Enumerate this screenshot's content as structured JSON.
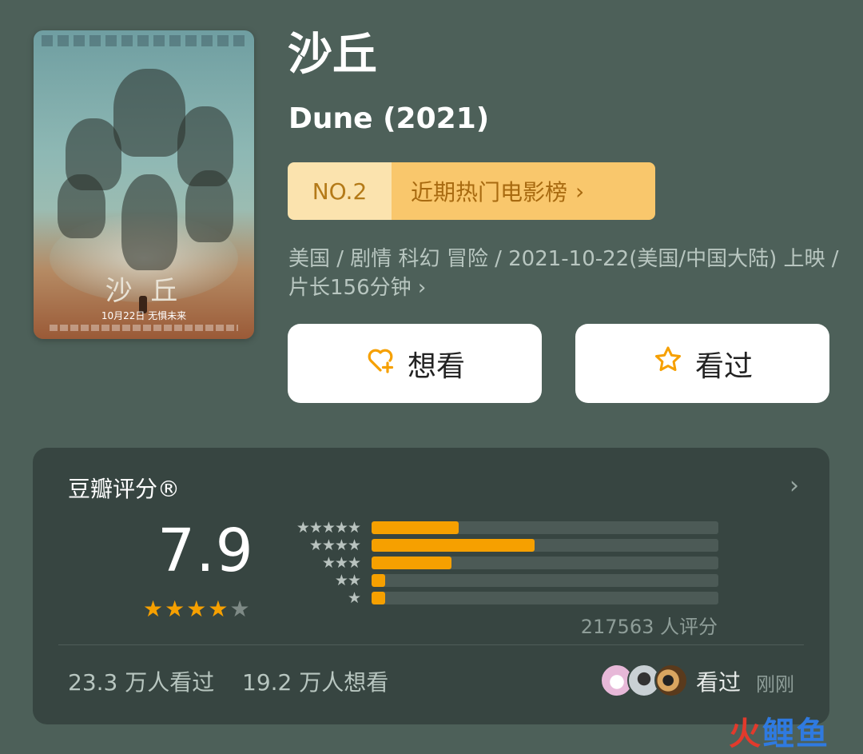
{
  "poster": {
    "title_art": "沙 丘",
    "date_line": "10月22日 无惧未来"
  },
  "movie": {
    "title_zh": "沙丘",
    "title_en": "Dune (2021)",
    "rank_label": "NO.2",
    "rank_list": "近期热门电影榜",
    "meta": "美国 / 剧情 科幻 冒险 / 2021-10-22(美国/中国大陆) 上映 / 片长156分钟"
  },
  "actions": {
    "want_label": "想看",
    "seen_label": "看过"
  },
  "rating": {
    "section_title": "豆瓣评分®",
    "score": "7.9",
    "stars": 4,
    "distribution": [
      {
        "stars": 5,
        "fraction": 0.25
      },
      {
        "stars": 4,
        "fraction": 0.47
      },
      {
        "stars": 3,
        "fraction": 0.23
      },
      {
        "stars": 2,
        "fraction": 0.04
      },
      {
        "stars": 1,
        "fraction": 0.04
      }
    ],
    "votes": "217563 人评分"
  },
  "stats": {
    "seen": "23.3 万人看过",
    "want": "19.2 万人想看"
  },
  "friend": {
    "action": "看过",
    "time": "刚刚"
  },
  "watermark": {
    "part1": "火",
    "part2": "鲤鱼"
  },
  "colors": {
    "accent": "#f6a000",
    "rank_light": "#fbe3ae",
    "rank_dark": "#f9c76c",
    "card_bg": "#374541",
    "page_bg": "#4d6059"
  }
}
